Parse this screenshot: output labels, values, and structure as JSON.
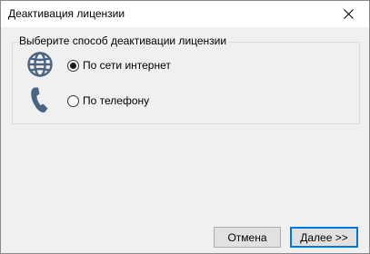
{
  "window": {
    "title": "Деактивация лицензии"
  },
  "group": {
    "label": "Выберите способ деактивации лицензии",
    "options": [
      {
        "label": "По сети интернет",
        "icon": "globe-icon",
        "selected": true
      },
      {
        "label": "По телефону",
        "icon": "phone-icon",
        "selected": false
      }
    ]
  },
  "buttons": {
    "cancel_label": "Отмена",
    "next_label": "Далее >>"
  },
  "colors": {
    "icon": "#4a6484",
    "accent": "#0078d7"
  }
}
